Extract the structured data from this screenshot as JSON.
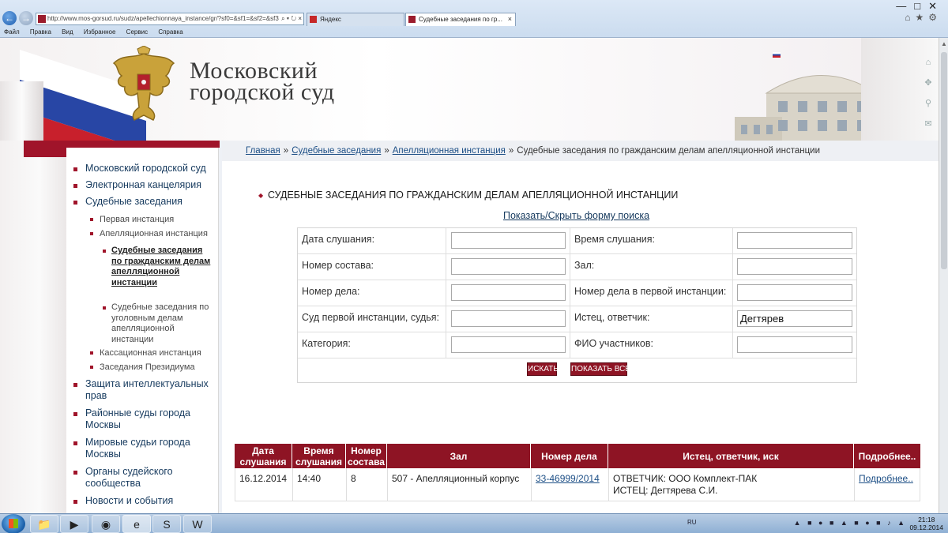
{
  "browser": {
    "address": "http://www.mos-gorsud.ru/sudz/apellechionnaya_instance/gr/?sf0=&sf1=&sf2=&sf3=",
    "tabs": [
      {
        "label": "Яндекс"
      },
      {
        "label": "Судебные заседания по гр..."
      }
    ],
    "menu": [
      "Файл",
      "Правка",
      "Вид",
      "Избранное",
      "Сервис",
      "Справка"
    ]
  },
  "header": {
    "title_line1": "Московский",
    "title_line2": "городской суд"
  },
  "breadcrumb": {
    "home": "Главная",
    "sessions": "Судебные заседания",
    "appeal": "Апелляционная инстанция",
    "current": "Судебные заседания по гражданским делам апелляционной инстанции",
    "separator": "»"
  },
  "sidebar": {
    "items": [
      {
        "label": "Московский городской суд"
      },
      {
        "label": "Электронная канцелярия"
      },
      {
        "label": "Судебные заседания"
      },
      {
        "label": "Защита интеллектуальных прав"
      },
      {
        "label": "Районные суды города Москвы"
      },
      {
        "label": "Мировые судьи города Москвы"
      },
      {
        "label": "Органы судейского сообщества"
      },
      {
        "label": "Новости и события"
      }
    ],
    "sub_items": [
      {
        "label": "Первая инстанция"
      },
      {
        "label": "Апелляционная инстанция"
      },
      {
        "label": "Кассационная инстанция"
      },
      {
        "label": "Заседания Президиума"
      }
    ],
    "sub_sub_items": [
      {
        "label": "Судебные заседания по гражданским делам апелляционной инстанции"
      },
      {
        "label": "Судебные заседания по уголовным делам апелляционной инстанции"
      }
    ]
  },
  "main": {
    "title": "СУДЕБНЫЕ ЗАСЕДАНИЯ ПО ГРАЖДАНСКИМ ДЕЛАМ АПЕЛЛЯЦИОННОЙ ИНСТАНЦИИ",
    "toggle_link": "Показать/Скрыть форму поиска"
  },
  "form": {
    "hearing_date": {
      "label": "Дата слушания:",
      "value": ""
    },
    "hearing_time": {
      "label": "Время слушания:",
      "value": ""
    },
    "panel_number": {
      "label": "Номер состава:",
      "value": ""
    },
    "hall": {
      "label": "Зал:",
      "value": ""
    },
    "case_number": {
      "label": "Номер дела:",
      "value": ""
    },
    "first_case_number": {
      "label": "Номер дела в первой инстанции:",
      "value": ""
    },
    "first_court": {
      "label": "Суд первой инстанции, судья:",
      "value": ""
    },
    "parties": {
      "label": "Истец, ответчик:",
      "value": "Дегтярев"
    },
    "category": {
      "label": "Категория:",
      "value": ""
    },
    "participants": {
      "label": "ФИО участников:",
      "value": ""
    },
    "search_button": "ИСКАТЬ",
    "show_all_button": "ПОКАЗАТЬ ВСЕ"
  },
  "results": {
    "headers": {
      "date": "Дата слушания",
      "time": "Время слушания",
      "panel": "Номер состава",
      "hall": "Зал",
      "case": "Номер дела",
      "parties": "Истец, ответчик, иск",
      "more": "Подробнее.."
    },
    "rows": [
      {
        "date": "16.12.2014",
        "time": "14:40",
        "panel": "8",
        "hall": "507 - Апелляционный корпус",
        "case": "33-46999/2014",
        "defendant": "ОТВЕТЧИК: ООО Комплект-ПАК",
        "plaintiff": "ИСТЕЦ: Дегтярева С.И.",
        "more": "Подробнее.."
      }
    ]
  },
  "taskbar": {
    "lang": "RU",
    "time": "21:18",
    "date": "09.12.2014"
  },
  "colors": {
    "accent": "#8e1424",
    "link": "#1d4f86"
  }
}
